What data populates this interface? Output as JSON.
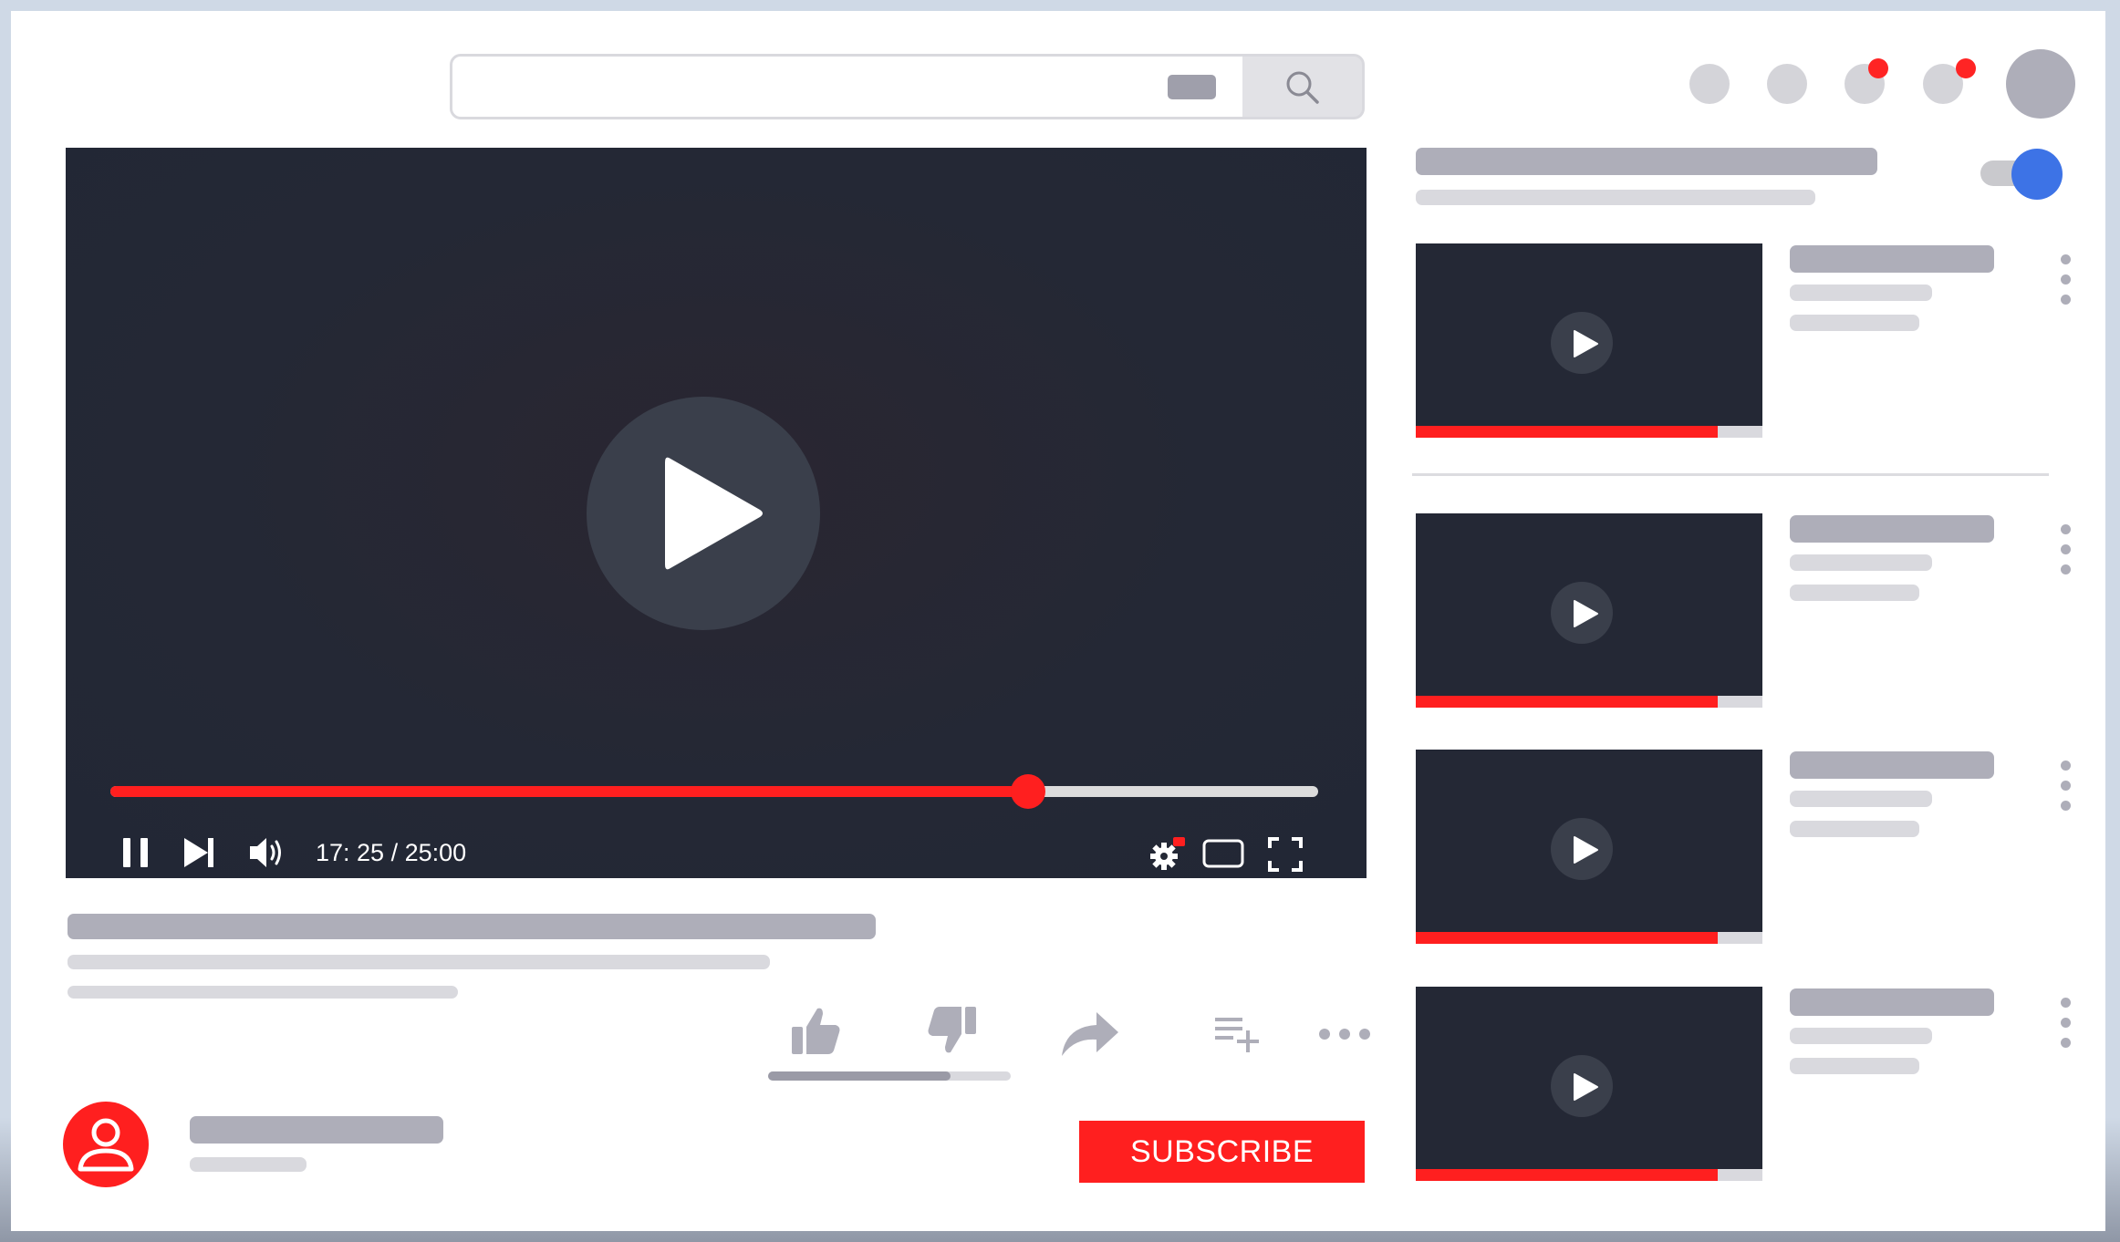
{
  "search": {
    "value": "",
    "placeholder": ""
  },
  "player": {
    "time_display": "17: 25 / 25:00",
    "progress_fraction": 0.76
  },
  "engagement": {
    "like_ratio_fraction": 0.75
  },
  "channel": {
    "subscribe_label": "SUBSCRIBE"
  },
  "sidebar": {
    "autoplay_on": true,
    "videos": [
      {
        "watched_fraction": 0.87
      },
      {
        "watched_fraction": 0.87
      },
      {
        "watched_fraction": 0.87
      },
      {
        "watched_fraction": 0.87
      }
    ]
  },
  "colors": {
    "accent_red": "#ff1f1f",
    "player_bg": "#242835",
    "toggle_blue": "#3d73e6",
    "skeleton_dark": "#aeaeb9",
    "skeleton_light": "#d9d9de"
  },
  "icons": {
    "search": "search-icon",
    "play": "play-icon",
    "pause": "pause-icon",
    "next": "skip-next-icon",
    "volume": "volume-icon",
    "settings": "settings-gear-icon",
    "theater": "theater-mode-icon",
    "fullscreen": "fullscreen-icon",
    "like": "thumbs-up-icon",
    "dislike": "thumbs-down-icon",
    "share": "share-arrow-icon",
    "save": "add-to-playlist-icon",
    "more": "more-horizontal-icon",
    "channel_avatar": "user-avatar-icon",
    "kebab": "more-vertical-icon"
  }
}
